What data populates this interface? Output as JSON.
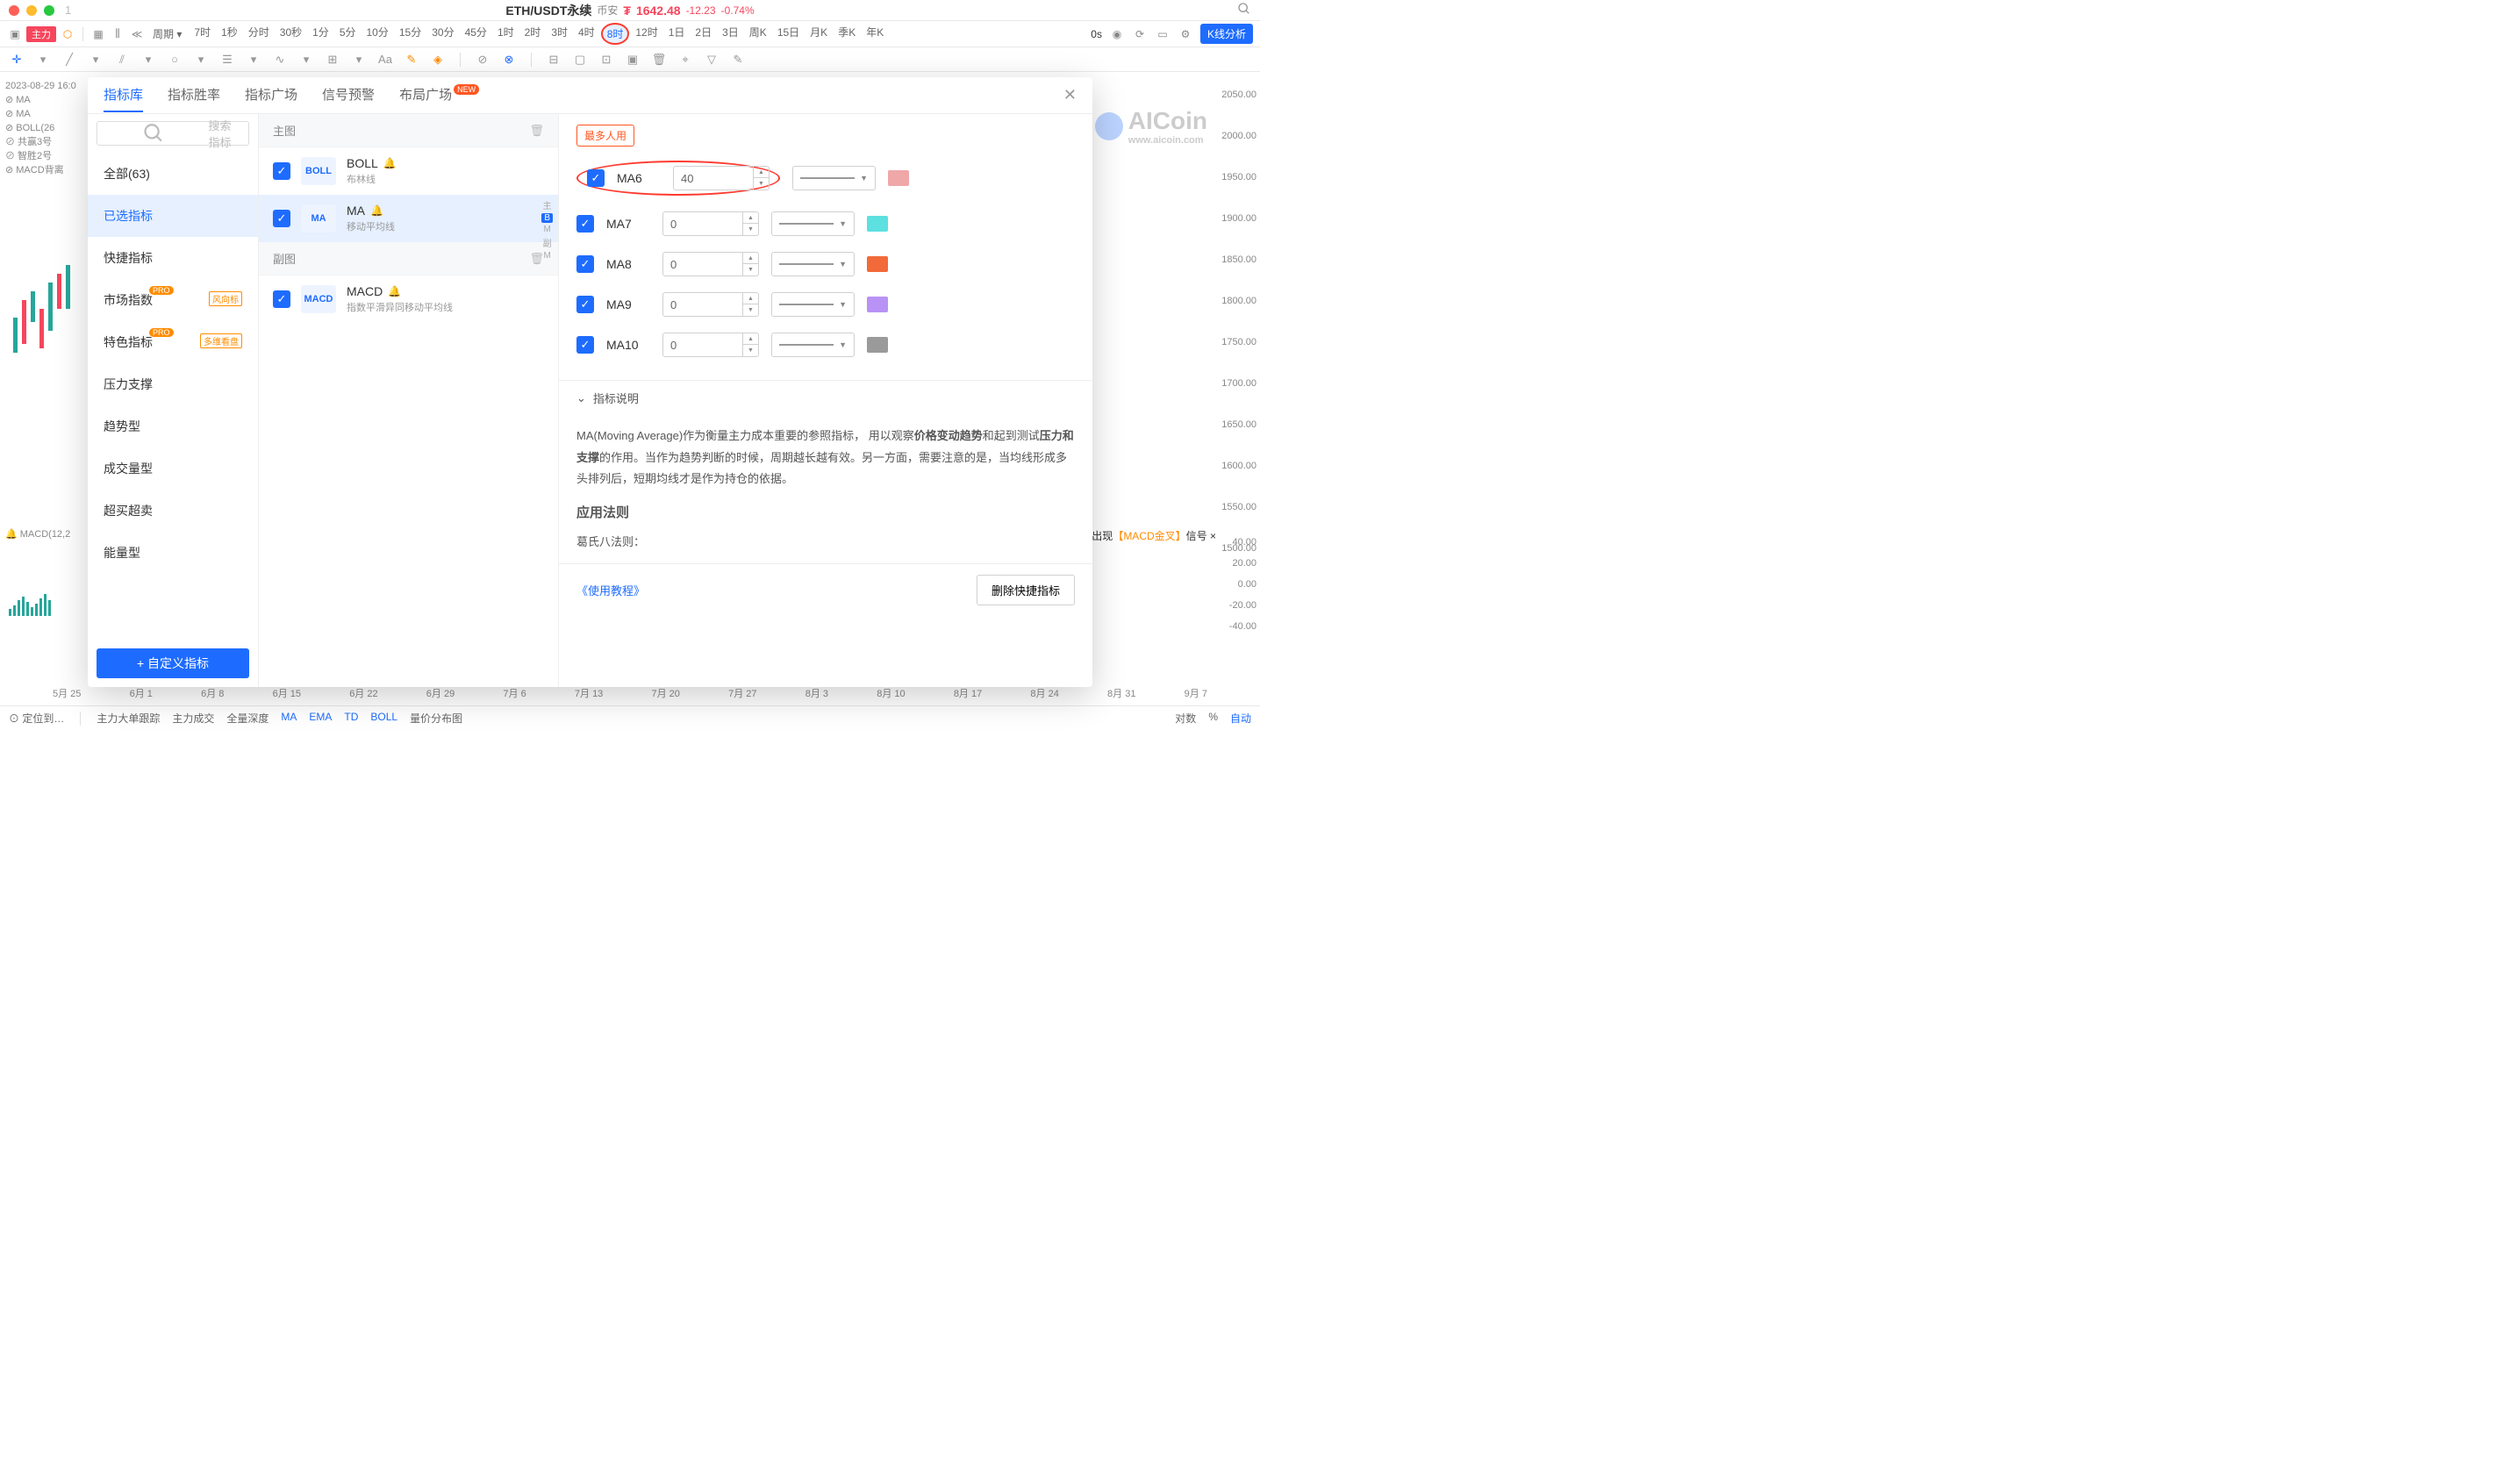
{
  "titlebar": {
    "symbol": "ETH/USDT永续",
    "exchange": "币安",
    "price": "1642.48",
    "change_abs": "-12.23",
    "change_pct": "-0.74%",
    "currency_symbol": "₮",
    "page_num": "1"
  },
  "timebar": {
    "main_label": "主力",
    "period_label": "周期",
    "frames": [
      "7时",
      "1秒",
      "分时",
      "30秒",
      "1分",
      "5分",
      "10分",
      "15分",
      "30分",
      "45分",
      "1时",
      "2时",
      "3时",
      "4时",
      "8时",
      "12时",
      "1日",
      "2日",
      "3日",
      "周K",
      "15日",
      "月K",
      "季K",
      "年K"
    ],
    "selected": "8时",
    "zoom": "0s",
    "kline_btn": "K线分析"
  },
  "chart": {
    "datetime": "2023-08-29 16:0",
    "indicators_vis": [
      "MA",
      "MA",
      "BOLL(26",
      "共赢3号",
      "智胜2号",
      "MACD背离"
    ],
    "y_ticks": [
      "2050.00",
      "2000.00",
      "1950.00",
      "1900.00",
      "1850.00",
      "1800.00",
      "1750.00",
      "1700.00",
      "1650.00",
      "1600.00",
      "1550.00",
      "1500.00"
    ],
    "x_ticks": [
      "5月 25",
      "6月 1",
      "6月 8",
      "6月 15",
      "6月 22",
      "6月 29",
      "7月 6",
      "7月 13",
      "7月 20",
      "7月 27",
      "8月 3",
      "8月 10",
      "8月 17",
      "8月 24",
      "8月 31",
      "9月 7"
    ],
    "watermark": "AICoin",
    "watermark_sub": "www.aicoin.com",
    "macd_label": "MACD(12,2",
    "macd_ticks": [
      "40.00",
      "20.00",
      "0.00",
      "-20.00",
      "-40.00"
    ],
    "signal": {
      "prefix": "BTC出现",
      "keyword": "【MACD金叉】",
      "suffix": "信号 ×"
    }
  },
  "modal": {
    "tabs": [
      {
        "label": "指标库",
        "selected": true
      },
      {
        "label": "指标胜率"
      },
      {
        "label": "指标广场"
      },
      {
        "label": "信号预警"
      },
      {
        "label": "布局广场",
        "new": "NEW"
      }
    ],
    "search_placeholder": "搜索指标",
    "categories": [
      {
        "label": "全部(63)"
      },
      {
        "label": "已选指标",
        "selected": true
      },
      {
        "label": "快捷指标"
      },
      {
        "label": "市场指数",
        "pro": "PRO",
        "tag": "风向标"
      },
      {
        "label": "特色指标",
        "pro": "PRO",
        "tag": "多维看盘"
      },
      {
        "label": "压力支撑"
      },
      {
        "label": "趋势型"
      },
      {
        "label": "成交量型"
      },
      {
        "label": "超买超卖"
      },
      {
        "label": "能量型"
      }
    ],
    "custom_btn": "+ 自定义指标",
    "section_main": "主图",
    "section_sub": "副图",
    "side_labels": {
      "zhu": "主",
      "B": "B",
      "M": "M",
      "fu": "副"
    },
    "indicators": [
      {
        "icon": "BOLL",
        "name": "BOLL",
        "desc": "布林线"
      },
      {
        "icon": "MA",
        "name": "MA",
        "desc": "移动平均线",
        "selected": true
      },
      {
        "icon": "MACD",
        "name": "MACD",
        "desc": "指数平滑异同移动平均线"
      }
    ],
    "popular_tag": "最多人用",
    "ma_params": [
      {
        "label": "MA6",
        "value": "40",
        "color": "#f0a7a7",
        "highlighted": true
      },
      {
        "label": "MA7",
        "value": "0",
        "color": "#5de0e0"
      },
      {
        "label": "MA8",
        "value": "0",
        "color": "#f26a3a"
      },
      {
        "label": "MA9",
        "value": "0",
        "color": "#b892f5"
      },
      {
        "label": "MA10",
        "value": "0",
        "color": "#9a9a9a"
      }
    ],
    "desc": {
      "head": "指标说明",
      "text_parts": [
        "MA(Moving Average)作为衡量主力成本重要的参照指标， 用以观察",
        "价格变动趋势",
        "和起到测试",
        "压力和支撑",
        "的作用。当作为趋势判断的时候，周期越长越有效。另一方面，需要注意的是，当均线形成多头排列后，短期均线才是作为持仓的依据。"
      ],
      "rule_head": "应用法则",
      "rule_text": "葛氏八法则："
    },
    "tutorial_link": "《使用教程》",
    "delete_btn": "删除快捷指标"
  },
  "bottombar": {
    "locate": "定位到…",
    "items": [
      "主力大单跟踪",
      "主力成交",
      "全量深度",
      "MA",
      "EMA",
      "TD",
      "BOLL",
      "量价分布图"
    ],
    "blue_items": [
      "MA",
      "EMA",
      "TD",
      "BOLL"
    ],
    "right": [
      "对数",
      "%",
      "自动"
    ]
  }
}
